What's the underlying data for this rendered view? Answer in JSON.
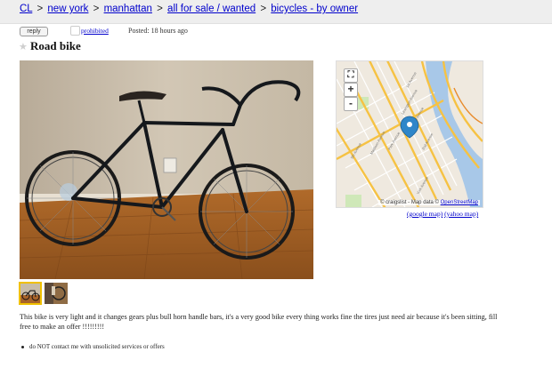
{
  "breadcrumb": {
    "items": [
      "CL",
      "new york",
      "manhattan",
      "all for sale / wanted",
      "bicycles - by owner"
    ],
    "separator": ">"
  },
  "actions": {
    "reply_label": "reply",
    "prohibited_label": "prohibited",
    "posted_label": "Posted:",
    "posted_value": "18 hours ago"
  },
  "posting": {
    "title": "Road bike",
    "body": "This bike is very light and it changes gears plus bull horn handle bars, it's a very good bike every thing works fine the tires just need air because it's been sitting, fill free to make an offer !!!!!!!!!",
    "notices": [
      "do NOT contact me with unsolicited services or offers"
    ]
  },
  "map": {
    "zoom_in": "+",
    "zoom_out": "-",
    "fullscreen_icon": "fullscreen-icon",
    "attribution_prefix": "© craigslist - Map data ©",
    "attribution_link": "OpenStreetMap",
    "google_link": "(google map)",
    "yahoo_link": "(yahoo map)",
    "street_labels": [
      "5th Avenue",
      "Madison Avenue",
      "Park Avenue",
      "Lexington Avenue",
      "3rd Avenue",
      "2nd Avenue",
      "1st Avenue",
      "York Avenue"
    ]
  },
  "colors": {
    "link": "#0000cc",
    "breadcrumb_bg": "#eeeeee",
    "thumb_selected": "#f0c000",
    "map_pin": "#2f86c9",
    "road_major": "#f6c243",
    "water": "#a8c8e8",
    "park": "#cfe8b8"
  }
}
